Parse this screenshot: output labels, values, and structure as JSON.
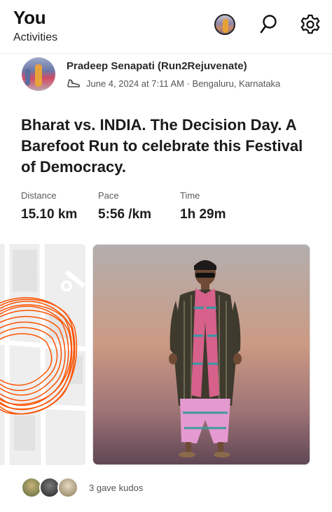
{
  "header": {
    "title": "You",
    "subtitle": "Activities",
    "icons": [
      "profile-avatar",
      "search-icon",
      "settings-gear-icon"
    ]
  },
  "post": {
    "athlete_name": "Pradeep Senapati (Run2Rejuvenate)",
    "meta": "June 4, 2024 at 7:11 AM · Bengaluru, Karnataka",
    "activity_icon": "shoe-icon",
    "title": "Bharat vs. INDIA. The Decision Day. A Barefoot Run to celebrate this Festival of Democracy."
  },
  "stats": [
    {
      "label": "Distance",
      "value": "15.10 km"
    },
    {
      "label": "Pace",
      "value": "5:56 /km"
    },
    {
      "label": "Time",
      "value": "1h 29m"
    }
  ],
  "media": {
    "map_route_color": "#fc5200",
    "photo_description_icon": "photo"
  },
  "kudos": {
    "text": "3 gave kudos",
    "count": 3
  },
  "colors": {
    "accent": "#fc5200",
    "text_primary": "#1b1b1b",
    "text_secondary": "#555555"
  }
}
